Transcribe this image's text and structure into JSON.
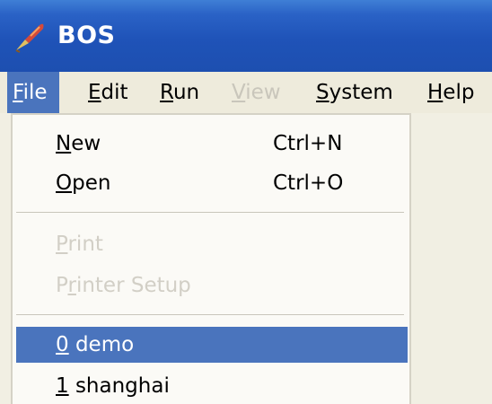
{
  "window": {
    "title": "BOS",
    "icon": "feather-brush-icon"
  },
  "menubar": {
    "items": [
      {
        "key": "file",
        "mnemonic": "F",
        "rest": "ile",
        "state": "active"
      },
      {
        "key": "edit",
        "mnemonic": "E",
        "rest": "dit",
        "state": "normal"
      },
      {
        "key": "run",
        "mnemonic": "R",
        "rest": "un",
        "state": "normal"
      },
      {
        "key": "view",
        "mnemonic": "V",
        "rest": "iew",
        "state": "disabled"
      },
      {
        "key": "system",
        "mnemonic": "S",
        "rest": "ystem",
        "state": "normal"
      },
      {
        "key": "help",
        "mnemonic": "H",
        "rest": "elp",
        "state": "normal"
      }
    ]
  },
  "file_menu": {
    "new": {
      "mnemonic": "N",
      "rest": "ew",
      "shortcut": "Ctrl+N"
    },
    "open": {
      "mnemonic": "O",
      "rest": "pen",
      "shortcut": "Ctrl+O"
    },
    "print": {
      "mnemonic": "P",
      "rest": "rint",
      "state": "disabled"
    },
    "printer_setup": {
      "pre": "P",
      "mnemonic": "r",
      "rest": "inter Setup",
      "state": "disabled"
    },
    "recent": [
      {
        "mnemonic": "0",
        "rest": " demo",
        "state": "selected"
      },
      {
        "mnemonic": "1",
        "rest": " shanghai",
        "state": "normal"
      }
    ]
  },
  "colors": {
    "titlebar": "#1f53b8",
    "highlight": "#4a74bd",
    "menubar": "#eeebdc",
    "disabled_text": "#d2cfc6"
  }
}
